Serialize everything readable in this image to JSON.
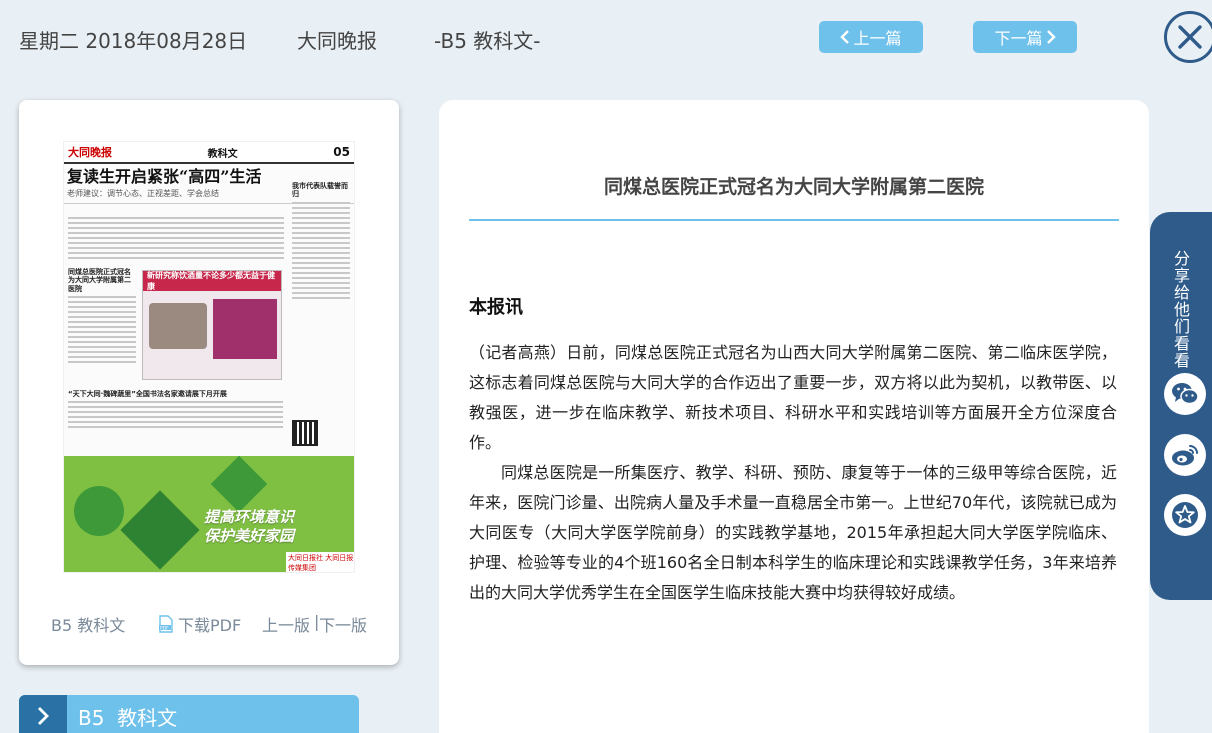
{
  "header": {
    "date": "星期二 2018年08月28日",
    "paper_name": "大同晚报",
    "section": "-B5 教科文-",
    "prev_label": "上一篇",
    "next_label": "下一篇"
  },
  "thumbnail": {
    "masthead": "大同晚报",
    "section": "教科文",
    "page_no": "05",
    "headline": "复读生开启紧张“高四”生活",
    "subline": "老师建议：调节心态、正视差距、学会总结",
    "side_head": "我市代表队载誉而归",
    "story_head": "同煤总医院正式冠名为大同大学附属第二医院",
    "story_head2": "“天下大同·魏碑蔬里”全国书法名家邀请展下月开展",
    "ad_banner": "新研究称饮酒量不论多少都无益于健康",
    "green_ad": [
      "提高环境意识",
      "保护美好家园"
    ],
    "green_ad_note": "大同日报社 大同日报传媒集团"
  },
  "thumb_footer": {
    "section": "B5 教科文",
    "pdf": "下载PDF",
    "prev_page": "上一版",
    "separator": "|",
    "next_page": "下一版"
  },
  "bottom_tab": {
    "label": "B5  教科文"
  },
  "article": {
    "title": "同煤总医院正式冠名为大同大学附属第二医院",
    "lead": "本报讯",
    "paragraphs": [
      "（记者高燕）日前，同煤总医院正式冠名为山西大同大学附属第二医院、第二临床医学院，这标志着同煤总医院与大同大学的合作迈出了重要一步，双方将以此为契机，以教带医、以教强医，进一步在临床教学、新技术项目、科研水平和实践培训等方面展开全方位深度合作。",
      "同煤总医院是一所集医疗、教学、科研、预防、康复等于一体的三级甲等综合医院，近年来，医院门诊量、出院病人量及手术量一直稳居全市第一。上世纪70年代，该院就已成为大同医专（大同大学医学院前身）的实践教学基地，2015年承担起大同大学医学院临床、护理、检验等专业的4个班160名全日制本科学生的临床理论和实践课教学任务，3年来培养出的大同大学优秀学生在全国医学生临床技能大赛中均获得较好成绩。"
    ]
  },
  "share": {
    "label": "分享给他们看看",
    "icons": [
      "wechat-icon",
      "weibo-icon",
      "favorite-icon"
    ]
  },
  "colors": {
    "accent_blue": "#6ec1eb",
    "dark_blue": "#2f5b8b",
    "background": "#e9f0f5"
  }
}
